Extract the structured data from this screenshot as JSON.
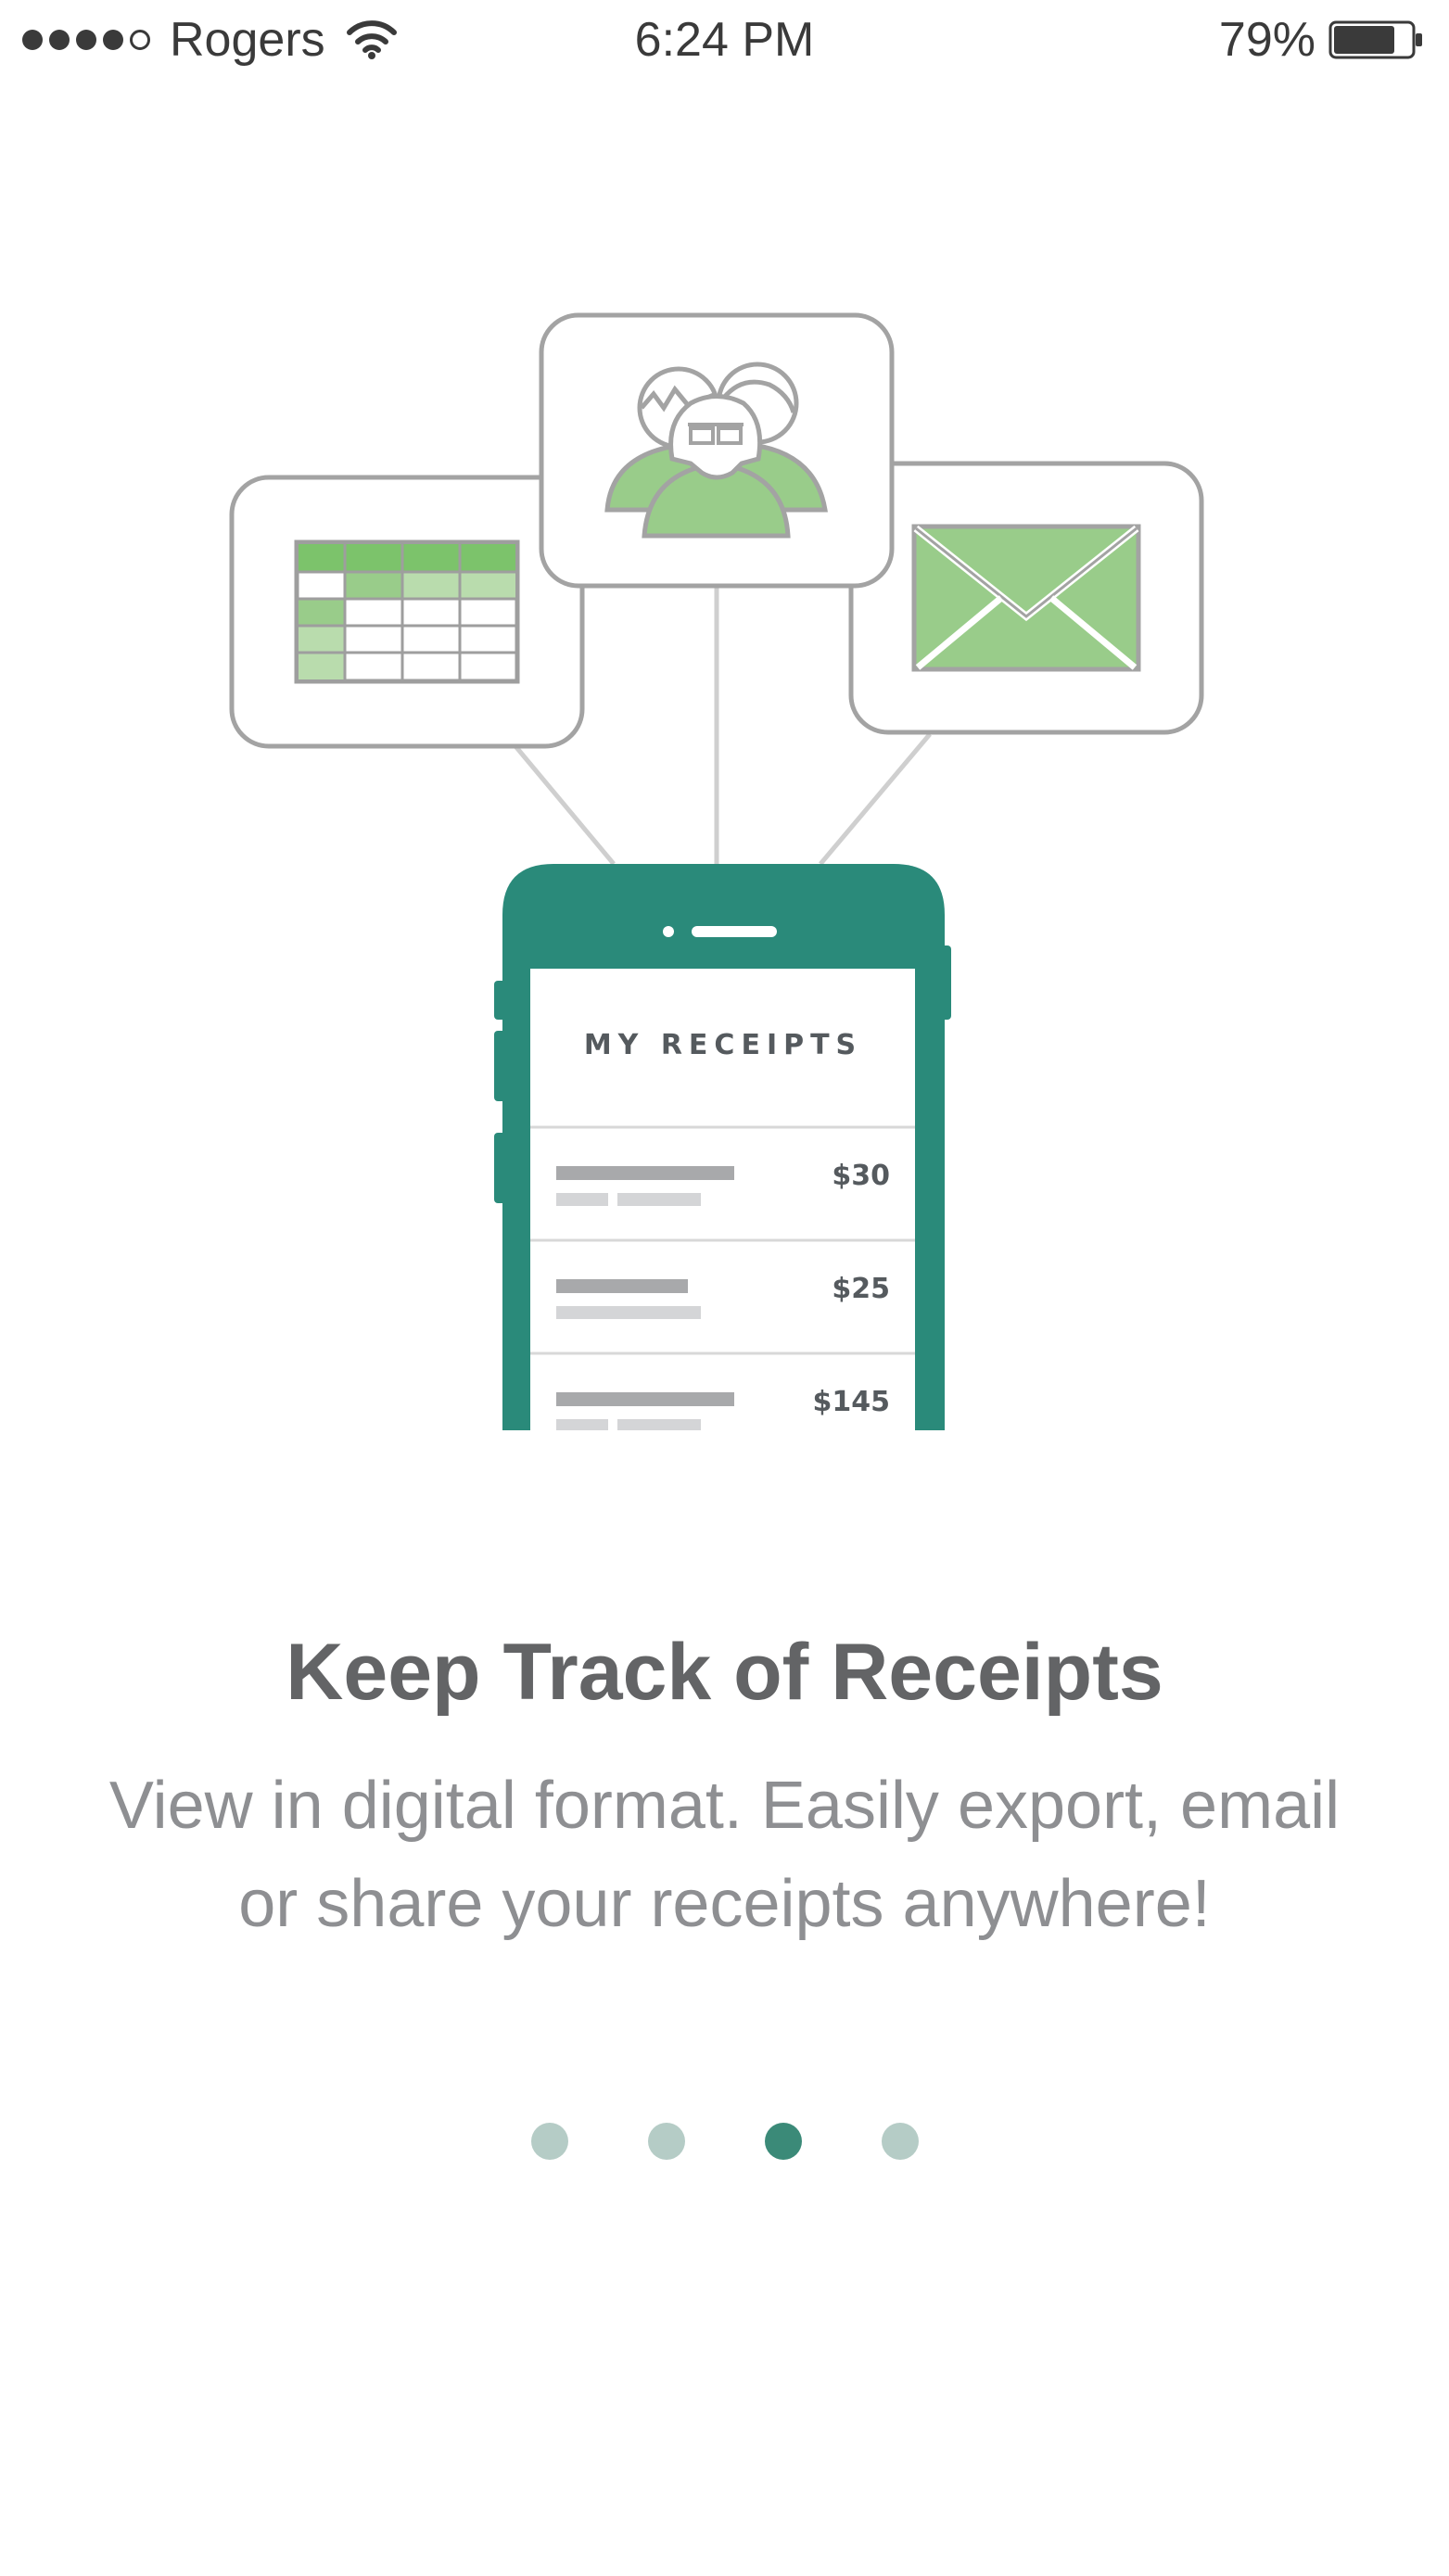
{
  "status_bar": {
    "signal_strength": 4,
    "signal_total": 5,
    "carrier": "Rogers",
    "wifi_icon": "wifi-icon",
    "time": "6:24 PM",
    "battery_percent_label": "79%",
    "battery_level": 0.79,
    "battery_icon": "battery-icon"
  },
  "illustration": {
    "cards": [
      {
        "icon": "spreadsheet-icon"
      },
      {
        "icon": "users-group-icon"
      },
      {
        "icon": "envelope-icon"
      }
    ],
    "phone": {
      "screen_title": "MY RECEIPTS",
      "receipts": [
        {
          "amount": "$30"
        },
        {
          "amount": "$25"
        },
        {
          "amount": "$145"
        }
      ]
    },
    "colors": {
      "phone_green": "#2a8a7a",
      "icon_green": "#99cc8a",
      "icon_green_dark": "#7cc36b",
      "outline_gray": "#a3a3a3"
    }
  },
  "onboarding": {
    "title": "Keep Track of Receipts",
    "subtitle": "View in digital format. Easily export, email or share your receipts anywhere!"
  },
  "pager": {
    "total": 4,
    "active_index": 2,
    "active_color": "#3b8a78",
    "inactive_color": "#b5ccc6"
  }
}
